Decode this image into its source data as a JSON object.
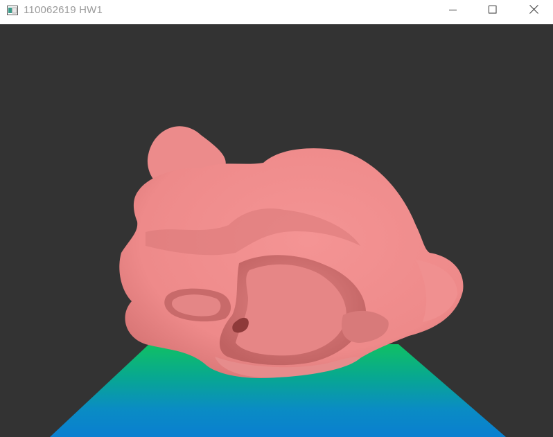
{
  "window": {
    "title": "110062619 HW1",
    "icon": "app-window-icon",
    "controls": {
      "minimize": "minimize-icon",
      "maximize": "maximize-icon",
      "close": "close-icon"
    }
  },
  "scene": {
    "background_color": "#333333",
    "model_color": "#ef8b8b",
    "floor_colors": [
      "#0fbd6a",
      "#0a8fc8",
      "#0a7fd0"
    ]
  }
}
